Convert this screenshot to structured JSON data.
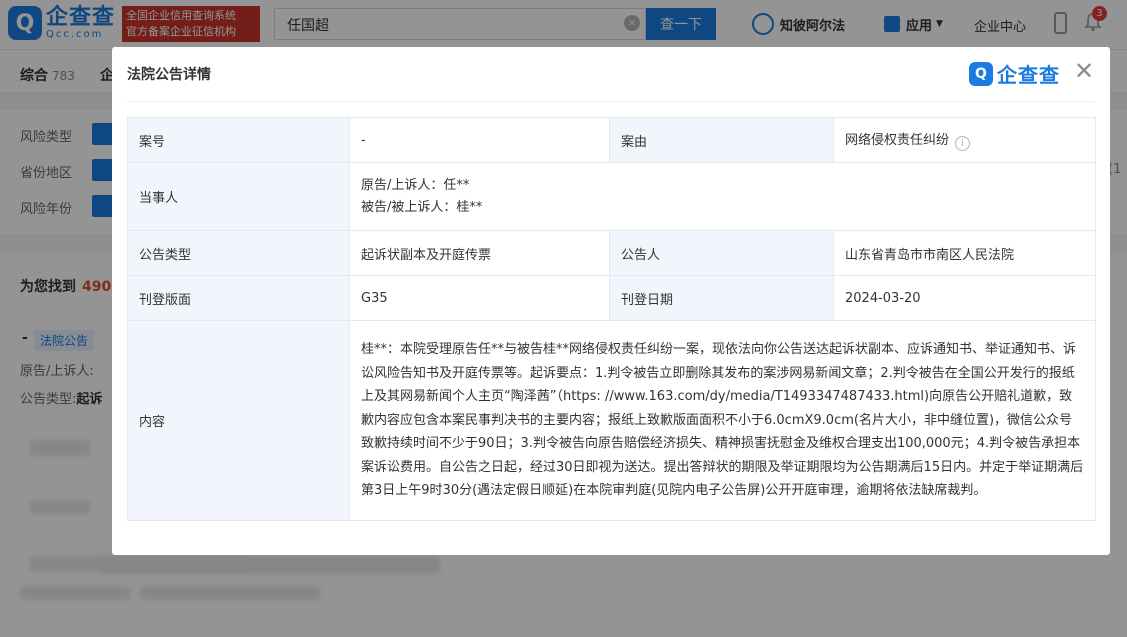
{
  "brand": {
    "logo_cn": "企查查",
    "logo_en": "Qcc.com",
    "slogan_line1": "全国企业信用查询系统",
    "slogan_line2": "官方备案企业征信机构",
    "accent_color": "#1a7be0"
  },
  "header": {
    "search_value": "任国超",
    "search_button": "查一下",
    "nav_law": "知彼阿尔法",
    "nav_app": "应用",
    "nav_enterprise": "企业中心",
    "notification_count": "3"
  },
  "tabs": {
    "first_label": "综合",
    "first_count": "783",
    "second_label": "企"
  },
  "filters": {
    "risk_type": "风险类型",
    "region": "省份地区",
    "risk_year": "风险年份",
    "right_hint": "(1"
  },
  "results": {
    "found_label": "为您找到",
    "found_count": "490",
    "tag": "法院公告",
    "line1_label": "原告/上诉人:",
    "line2_label": "公告类型:",
    "line2_value": "起诉"
  },
  "modal": {
    "title": "法院公告详情",
    "logo_text": "企查查",
    "close_symbol": "✕",
    "rows": {
      "case_no_label": "案号",
      "case_no_value": "-",
      "cause_label": "案由",
      "cause_value": "网络侵权责任纠纷",
      "party_label": "当事人",
      "party_plaintiff": "原告/上诉人：任**",
      "party_defendant": "被告/被上诉人：桂**",
      "type_label": "公告类型",
      "type_value": "起诉状副本及开庭传票",
      "announcer_label": "公告人",
      "announcer_value": "山东省青岛市市南区人民法院",
      "page_label": "刊登版面",
      "page_value": "G35",
      "date_label": "刊登日期",
      "date_value": "2024-03-20",
      "content_label": "内容",
      "content_value": "桂**：本院受理原告任**与被告桂**网络侵权责任纠纷一案，现依法向你公告送达起诉状副本、应诉通知书、举证通知书、诉讼风险告知书及开庭传票等。起诉要点：1.判令被告立即删除其发布的案涉网易新闻文章；2.判令被告在全国公开发行的报纸上及其网易新闻个人主页“陶泽茜”（https: //www.163.com/dy/media/T1493347487433.html)向原告公开赔礼道歉，致歉内容应包含本案民事判决书的主要内容；报纸上致歉版面面积不小于6.0cmX9.0cm(名片大小，非中缝位置)，微信公众号致歉持续时间不少于90日；3.判令被告向原告赔偿经济损失、精神损害抚慰金及维权合理支出100,000元；4.判令被告承担本案诉讼费用。自公告之日起，经过30日即视为送达。提出答辩状的期限及举证期限均为公告期满后15日内。并定于举证期满后第3日上午9时30分(遇法定假日顺延)在本院审判庭(见院内电子公告屏)公开开庭审理，逾期将依法缺席裁判。"
    }
  }
}
